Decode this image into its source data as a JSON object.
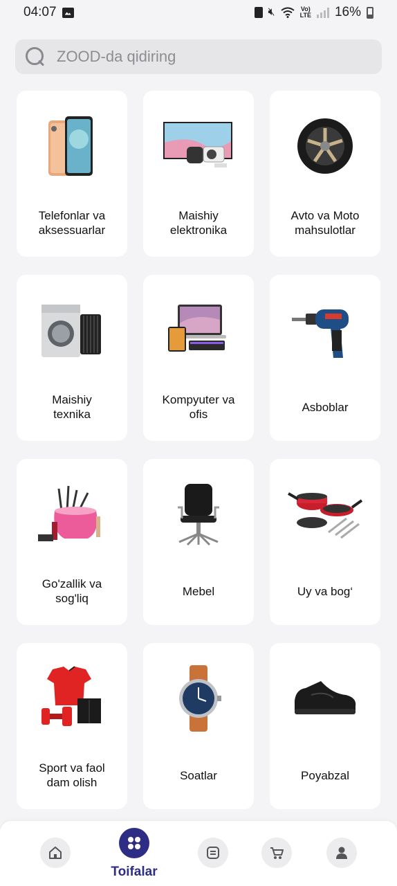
{
  "status_bar": {
    "time": "04:07",
    "battery": "16%"
  },
  "search": {
    "placeholder": "ZOOD-da qidiring",
    "icon": "search-icon"
  },
  "categories": [
    {
      "label": "Telefonlar va\naksessuarlar",
      "icon": "phone-icon"
    },
    {
      "label": "Maishiy\nelektronika",
      "icon": "tv-icon"
    },
    {
      "label": "Avto va Moto\nmahsulotlar",
      "icon": "wheel-icon"
    },
    {
      "label": "Maishiy\ntexnika",
      "icon": "washing-machine-icon"
    },
    {
      "label": "Kompyuter va\nofis",
      "icon": "laptop-icon"
    },
    {
      "label": "Asboblar",
      "icon": "drill-icon"
    },
    {
      "label": "Go'zallik va\nsog'liq",
      "icon": "cosmetics-icon"
    },
    {
      "label": "Mebel",
      "icon": "office-chair-icon"
    },
    {
      "label": "Uy va bog‘",
      "icon": "cookware-icon"
    },
    {
      "label": "Sport va faol\ndam olish",
      "icon": "sportswear-icon"
    },
    {
      "label": "Soatlar",
      "icon": "watch-icon"
    },
    {
      "label": "Poyabzal",
      "icon": "shoe-icon"
    }
  ],
  "bottom_nav": {
    "active_label": "Toifalar",
    "items": [
      "home-icon",
      "categories-icon",
      "feed-icon",
      "cart-icon",
      "profile-icon"
    ]
  },
  "colors": {
    "accent": "#2e2d86",
    "background": "#f4f4f6",
    "card": "#ffffff"
  }
}
